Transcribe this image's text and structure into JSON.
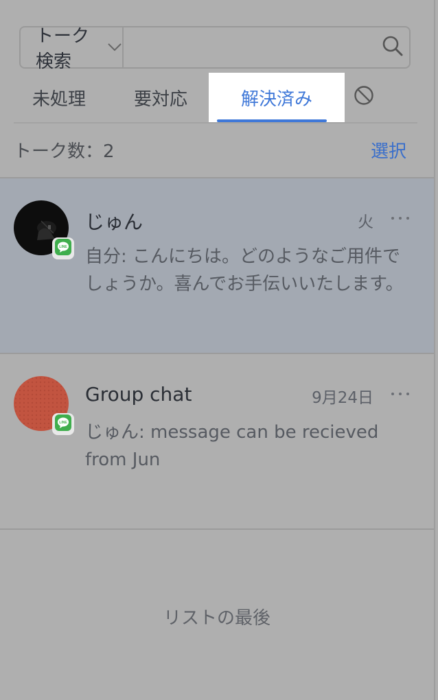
{
  "search": {
    "type_label": "トーク検索",
    "placeholder": ""
  },
  "tabs": [
    {
      "label": "未処理",
      "active": false
    },
    {
      "label": "要対応",
      "active": false
    },
    {
      "label": "解決済み",
      "active": true
    }
  ],
  "list_header": {
    "count_label": "トーク数：2",
    "select_label": "選択"
  },
  "conversations": [
    {
      "name": "じゅん",
      "time": "火",
      "preview": "自分: こんにちは。どのようなご用件でしょうか。喜んでお手伝いいたします。",
      "channel": "LINE",
      "selected": true
    },
    {
      "name": "Group chat",
      "time": "9月24日",
      "preview": "じゅん: message can be recieved from Jun",
      "channel": "LINE",
      "selected": false
    }
  ],
  "list_end_label": "リストの最後",
  "colors": {
    "accent": "#3f78d8",
    "selected_row": "#a3a9b2",
    "background": "#afafaf",
    "line_green": "#3fae4d",
    "avatar_group": "#c25440"
  },
  "icons": {
    "search": "search-icon",
    "dropdown": "chevron-down-icon",
    "blocked_tab": "prohibited-icon",
    "more": "more-horizontal-icon",
    "channel": "line-icon"
  }
}
